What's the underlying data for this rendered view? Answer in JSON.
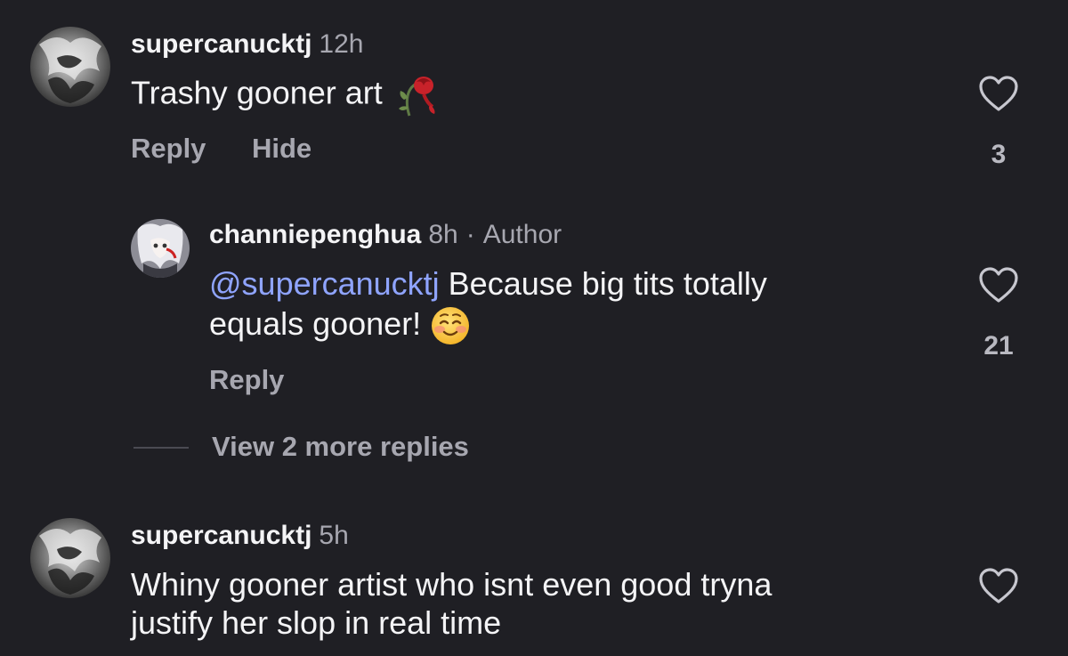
{
  "comments": [
    {
      "username": "supercanucktj",
      "time": "12h",
      "text": "Trashy gooner art",
      "emoji_icon": "wilted-rose-emoji",
      "reply_label": "Reply",
      "hide_label": "Hide",
      "likes": "3"
    },
    {
      "username": "channiepenghua",
      "time": "8h",
      "separator": "·",
      "author_label": "Author",
      "mention": "@supercanucktj",
      "text_line1": " Because big tits totally",
      "text_line2": "equals gooner! ",
      "emoji_icon": "smiling-face-emoji",
      "reply_label": "Reply",
      "likes": "21"
    },
    {
      "username": "supercanucktj",
      "time": "5h",
      "text_line1": "Whiny gooner artist who isnt even good tryna",
      "text_line2": "justify her slop in real time"
    }
  ],
  "view_more_replies": "View 2 more replies",
  "colors": {
    "background": "#1f1f24",
    "text": "#f4f4f6",
    "muted": "#a7a7b0",
    "mention": "#8fa4ff"
  }
}
